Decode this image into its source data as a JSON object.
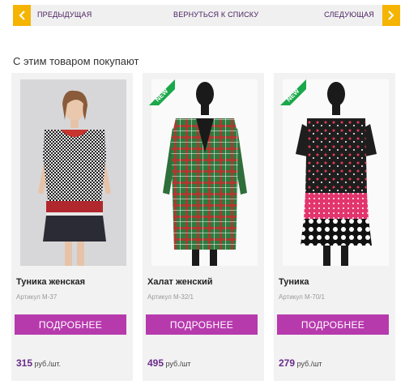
{
  "nav": {
    "prev_label": "ПРЕДЫДУЩАЯ",
    "back_label": "ВЕРНУТЬСЯ К СПИСКУ",
    "next_label": "СЛЕДУЮЩАЯ"
  },
  "section": {
    "title": "С этим товаром покупают"
  },
  "colors": {
    "accent": "#f5b400",
    "button": "#b73aad",
    "price": "#6a2b8a",
    "badge": "#1aa84a"
  },
  "products": [
    {
      "name": "Туника женская",
      "sku": "Артикул М-37",
      "button_label": "ПОДРОБНЕЕ",
      "price": "315",
      "unit": " руб./шт.",
      "new_badge": ""
    },
    {
      "name": "Халат женский",
      "sku": "Артикул М-32/1",
      "button_label": "ПОДРОБНЕЕ",
      "price": "495",
      "unit": " руб./шт",
      "new_badge": "NEW"
    },
    {
      "name": "Туника",
      "sku": "Артикул М-70/1",
      "button_label": "ПОДРОБНЕЕ",
      "price": "279",
      "unit": " руб./шт",
      "new_badge": "NEW"
    }
  ]
}
